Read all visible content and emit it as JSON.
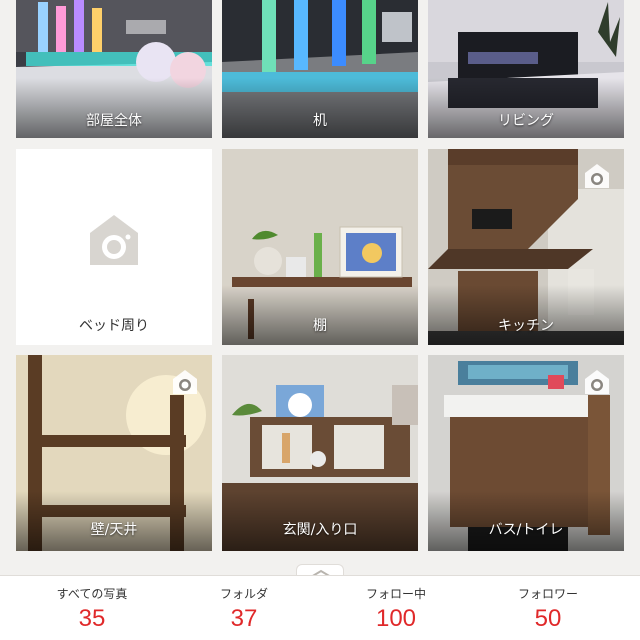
{
  "folders": [
    {
      "label": "部屋全体",
      "has_photo": true,
      "camera_badge": false
    },
    {
      "label": "机",
      "has_photo": true,
      "camera_badge": false
    },
    {
      "label": "リビング",
      "has_photo": true,
      "camera_badge": false
    },
    {
      "label": "ベッド周り",
      "has_photo": false,
      "camera_badge": false
    },
    {
      "label": "棚",
      "has_photo": true,
      "camera_badge": false
    },
    {
      "label": "キッチン",
      "has_photo": true,
      "camera_badge": true
    },
    {
      "label": "壁/天井",
      "has_photo": true,
      "camera_badge": true
    },
    {
      "label": "玄関/入り口",
      "has_photo": true,
      "camera_badge": false
    },
    {
      "label": "バス/トイレ",
      "has_photo": true,
      "camera_badge": true
    }
  ],
  "stats": [
    {
      "label": "すべての写真",
      "value": "35"
    },
    {
      "label": "フォルダ",
      "value": "37"
    },
    {
      "label": "フォロー中",
      "value": "100"
    },
    {
      "label": "フォロワー",
      "value": "50"
    }
  ],
  "colors": {
    "accent": "#e0292a",
    "background": "#f2f1ef",
    "placeholder_icon": "#d8d5d0"
  },
  "icons": {
    "camera_badge": "camera-icon",
    "empty_folder": "house-camera-icon",
    "handle": "chevron-up-icon"
  }
}
